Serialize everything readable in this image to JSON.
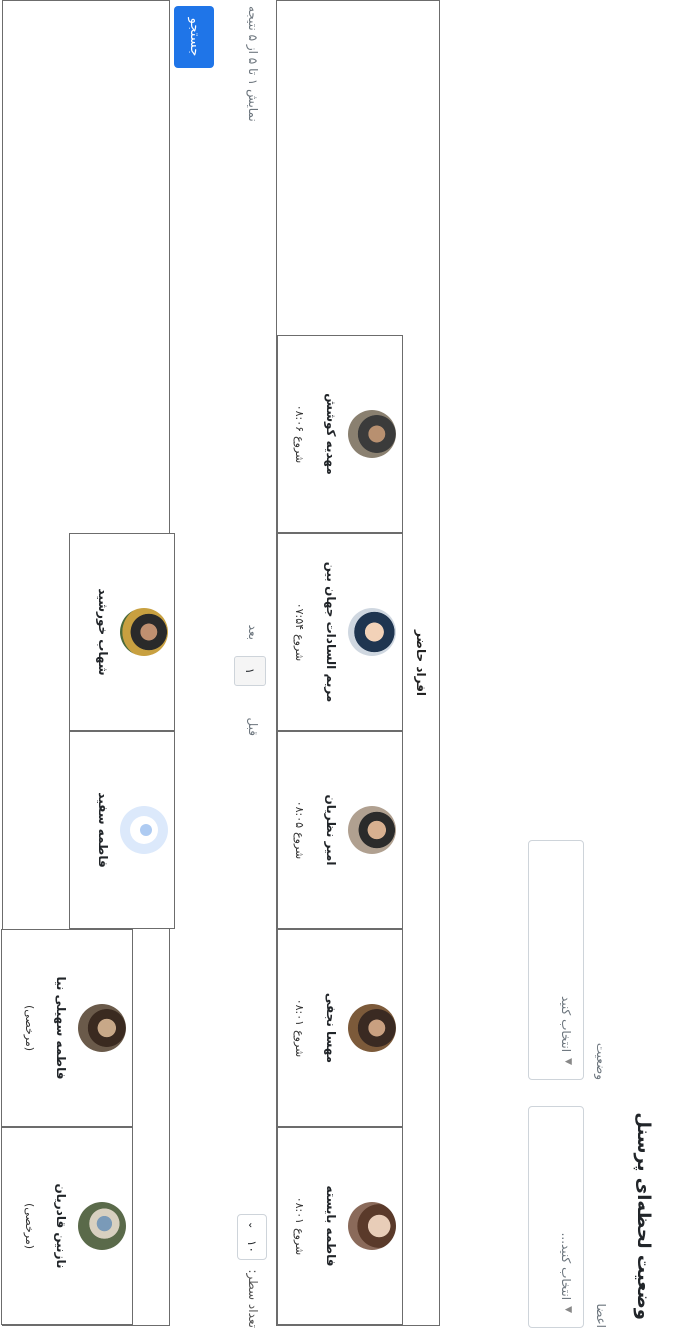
{
  "page_title": "وضعیت لحظه‌ای پرسنل",
  "filters": {
    "members": {
      "label": "اعضا",
      "placeholder": "انتخاب کنید..."
    },
    "status": {
      "label": "وضعیت",
      "placeholder": "انتخاب کنید"
    }
  },
  "present": {
    "title": "افراد حاضر",
    "people": [
      {
        "name": "فاطمه بایسته",
        "start_label": "شروع",
        "start_time": "۰۸:۰۱",
        "avatar": "person-photo"
      },
      {
        "name": "مهسا نجفی",
        "start_label": "شروع",
        "start_time": "۰۸:۰۱",
        "avatar": "person-photo"
      },
      {
        "name": "امیر نظریان",
        "start_label": "شروع",
        "start_time": "۰۸:۰۵",
        "avatar": "person-photo"
      },
      {
        "name": "مریم السادات جهان بین",
        "start_label": "شروع",
        "start_time": "۰۷:۵۴",
        "avatar": "person-photo"
      },
      {
        "name": "مهدیه کوشش",
        "start_label": "شروع",
        "start_time": "۰۸:۰۶",
        "avatar": "person-photo"
      }
    ]
  },
  "pagination": {
    "rows_label": "تعداد سطر:",
    "rows_value": "۱۰",
    "prev": "قبل",
    "page": "۱",
    "next": "بعد",
    "summary": "نمایش ۱ تا ۵ از ۵ نتیجه"
  },
  "search_button": "جستجو",
  "absent": {
    "title": "افراد غایب",
    "people": [
      {
        "name": "نازنین قادریان",
        "note": "(مرخصی)",
        "avatar": "person-photo"
      },
      {
        "name": "فاطمه سهیلی نیا",
        "note": "(مرخصی)",
        "avatar": "person-photo"
      },
      {
        "name": "فاطمه سفید",
        "note": "",
        "avatar": "user-placeholder-icon"
      },
      {
        "name": "شهاب خورشید",
        "note": "",
        "avatar": "person-photo"
      }
    ]
  },
  "colors": {
    "primary": "#1f75e8",
    "border": "#6c6c6c",
    "avatar_placeholder": "#dce9fb"
  }
}
